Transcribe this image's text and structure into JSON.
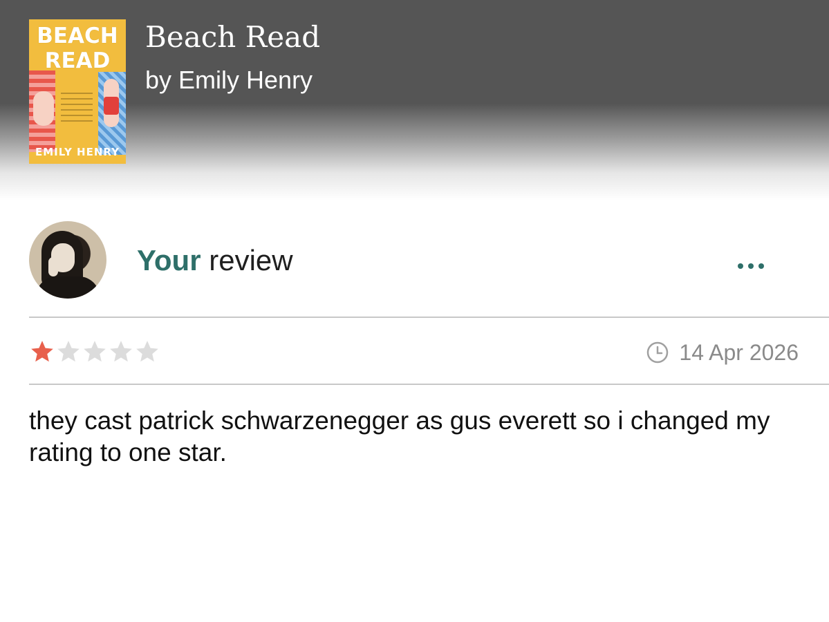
{
  "book": {
    "cover_title": "BEACH\nREAD",
    "cover_author": "EMILY HENRY",
    "title": "Beach Read",
    "author_line": "by Emily Henry"
  },
  "review": {
    "heading_prefix": "Your",
    "heading_suffix": " review",
    "rating": 1,
    "rating_max": 5,
    "date": "14 Apr 2026",
    "text": "they cast patrick schwarzenegger as gus everett so i changed my rating to one star."
  },
  "icons": {
    "more": "more-dots-icon",
    "clock": "clock-icon",
    "star": "star-icon"
  },
  "colors": {
    "accent": "#2e6f69",
    "star_filled": "#e8604c",
    "star_empty": "#dcdcdc",
    "header_bg": "#555555"
  }
}
